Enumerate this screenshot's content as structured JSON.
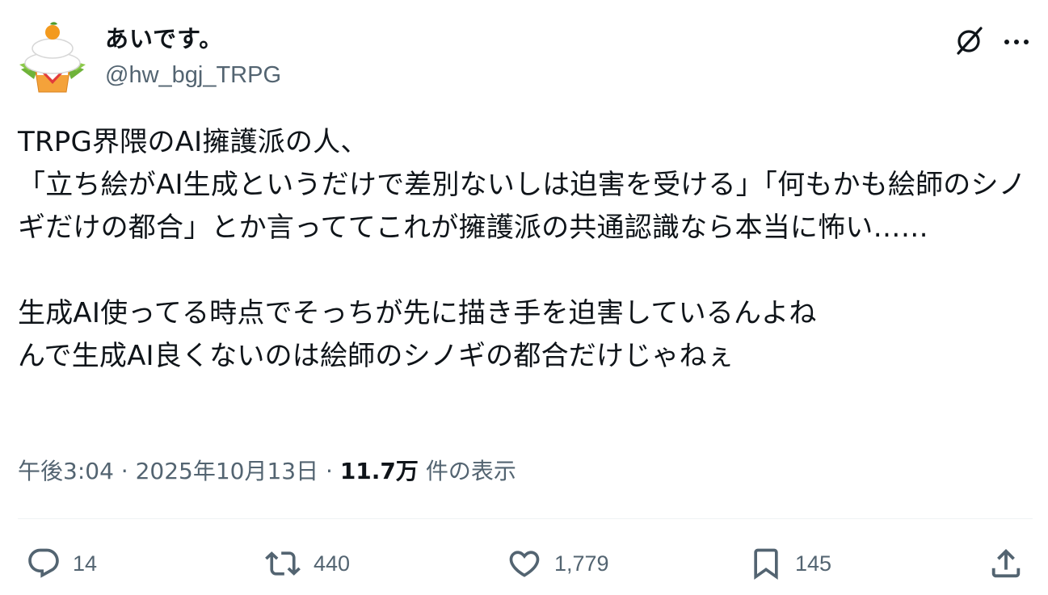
{
  "user": {
    "display_name": "あいです。",
    "handle": "@hw_bgj_TRPG"
  },
  "tweet": {
    "text": "TRPG界隈のAI擁護派の人、\n「立ち絵がAI生成というだけで差別ないしは迫害を受ける」「何もかも絵師のシノギだけの都合」とか言っててこれが擁護派の共通認識なら本当に怖い……\n\n生成AI使ってる時点でそっちが先に描き手を迫害しているんよね\nんで生成AI良くないのは絵師のシノギの都合だけじゃねぇ"
  },
  "meta": {
    "time": "午後3:04",
    "separator": " · ",
    "date": "2025年10月13日",
    "views_count": "11.7万",
    "views_label": " 件の表示"
  },
  "actions": {
    "reply_count": "14",
    "retweet_count": "440",
    "like_count": "1,779",
    "bookmark_count": "145"
  },
  "icons": {
    "grok": "grok-icon",
    "more": "more-icon",
    "reply": "reply-icon",
    "retweet": "retweet-icon",
    "like": "heart-icon",
    "bookmark": "bookmark-icon",
    "share": "share-icon"
  },
  "colors": {
    "text": "#0f1419",
    "secondary": "#536471",
    "divider": "#eff3f4"
  }
}
